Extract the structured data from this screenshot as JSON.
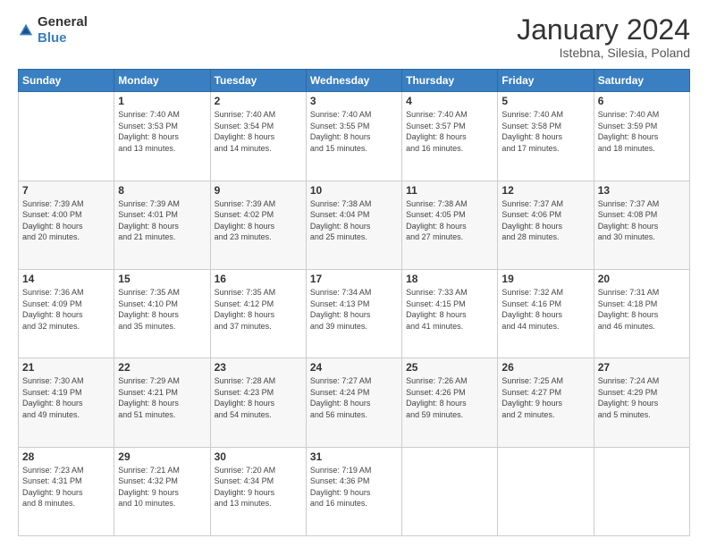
{
  "header": {
    "logo": {
      "general": "General",
      "blue": "Blue"
    },
    "title": "January 2024",
    "location": "Istebna, Silesia, Poland"
  },
  "calendar": {
    "days_of_week": [
      "Sunday",
      "Monday",
      "Tuesday",
      "Wednesday",
      "Thursday",
      "Friday",
      "Saturday"
    ],
    "weeks": [
      [
        {
          "day": "",
          "info": ""
        },
        {
          "day": "1",
          "info": "Sunrise: 7:40 AM\nSunset: 3:53 PM\nDaylight: 8 hours\nand 13 minutes."
        },
        {
          "day": "2",
          "info": "Sunrise: 7:40 AM\nSunset: 3:54 PM\nDaylight: 8 hours\nand 14 minutes."
        },
        {
          "day": "3",
          "info": "Sunrise: 7:40 AM\nSunset: 3:55 PM\nDaylight: 8 hours\nand 15 minutes."
        },
        {
          "day": "4",
          "info": "Sunrise: 7:40 AM\nSunset: 3:57 PM\nDaylight: 8 hours\nand 16 minutes."
        },
        {
          "day": "5",
          "info": "Sunrise: 7:40 AM\nSunset: 3:58 PM\nDaylight: 8 hours\nand 17 minutes."
        },
        {
          "day": "6",
          "info": "Sunrise: 7:40 AM\nSunset: 3:59 PM\nDaylight: 8 hours\nand 18 minutes."
        }
      ],
      [
        {
          "day": "7",
          "info": "Sunrise: 7:39 AM\nSunset: 4:00 PM\nDaylight: 8 hours\nand 20 minutes."
        },
        {
          "day": "8",
          "info": "Sunrise: 7:39 AM\nSunset: 4:01 PM\nDaylight: 8 hours\nand 21 minutes."
        },
        {
          "day": "9",
          "info": "Sunrise: 7:39 AM\nSunset: 4:02 PM\nDaylight: 8 hours\nand 23 minutes."
        },
        {
          "day": "10",
          "info": "Sunrise: 7:38 AM\nSunset: 4:04 PM\nDaylight: 8 hours\nand 25 minutes."
        },
        {
          "day": "11",
          "info": "Sunrise: 7:38 AM\nSunset: 4:05 PM\nDaylight: 8 hours\nand 27 minutes."
        },
        {
          "day": "12",
          "info": "Sunrise: 7:37 AM\nSunset: 4:06 PM\nDaylight: 8 hours\nand 28 minutes."
        },
        {
          "day": "13",
          "info": "Sunrise: 7:37 AM\nSunset: 4:08 PM\nDaylight: 8 hours\nand 30 minutes."
        }
      ],
      [
        {
          "day": "14",
          "info": "Sunrise: 7:36 AM\nSunset: 4:09 PM\nDaylight: 8 hours\nand 32 minutes."
        },
        {
          "day": "15",
          "info": "Sunrise: 7:35 AM\nSunset: 4:10 PM\nDaylight: 8 hours\nand 35 minutes."
        },
        {
          "day": "16",
          "info": "Sunrise: 7:35 AM\nSunset: 4:12 PM\nDaylight: 8 hours\nand 37 minutes."
        },
        {
          "day": "17",
          "info": "Sunrise: 7:34 AM\nSunset: 4:13 PM\nDaylight: 8 hours\nand 39 minutes."
        },
        {
          "day": "18",
          "info": "Sunrise: 7:33 AM\nSunset: 4:15 PM\nDaylight: 8 hours\nand 41 minutes."
        },
        {
          "day": "19",
          "info": "Sunrise: 7:32 AM\nSunset: 4:16 PM\nDaylight: 8 hours\nand 44 minutes."
        },
        {
          "day": "20",
          "info": "Sunrise: 7:31 AM\nSunset: 4:18 PM\nDaylight: 8 hours\nand 46 minutes."
        }
      ],
      [
        {
          "day": "21",
          "info": "Sunrise: 7:30 AM\nSunset: 4:19 PM\nDaylight: 8 hours\nand 49 minutes."
        },
        {
          "day": "22",
          "info": "Sunrise: 7:29 AM\nSunset: 4:21 PM\nDaylight: 8 hours\nand 51 minutes."
        },
        {
          "day": "23",
          "info": "Sunrise: 7:28 AM\nSunset: 4:23 PM\nDaylight: 8 hours\nand 54 minutes."
        },
        {
          "day": "24",
          "info": "Sunrise: 7:27 AM\nSunset: 4:24 PM\nDaylight: 8 hours\nand 56 minutes."
        },
        {
          "day": "25",
          "info": "Sunrise: 7:26 AM\nSunset: 4:26 PM\nDaylight: 8 hours\nand 59 minutes."
        },
        {
          "day": "26",
          "info": "Sunrise: 7:25 AM\nSunset: 4:27 PM\nDaylight: 9 hours\nand 2 minutes."
        },
        {
          "day": "27",
          "info": "Sunrise: 7:24 AM\nSunset: 4:29 PM\nDaylight: 9 hours\nand 5 minutes."
        }
      ],
      [
        {
          "day": "28",
          "info": "Sunrise: 7:23 AM\nSunset: 4:31 PM\nDaylight: 9 hours\nand 8 minutes."
        },
        {
          "day": "29",
          "info": "Sunrise: 7:21 AM\nSunset: 4:32 PM\nDaylight: 9 hours\nand 10 minutes."
        },
        {
          "day": "30",
          "info": "Sunrise: 7:20 AM\nSunset: 4:34 PM\nDaylight: 9 hours\nand 13 minutes."
        },
        {
          "day": "31",
          "info": "Sunrise: 7:19 AM\nSunset: 4:36 PM\nDaylight: 9 hours\nand 16 minutes."
        },
        {
          "day": "",
          "info": ""
        },
        {
          "day": "",
          "info": ""
        },
        {
          "day": "",
          "info": ""
        }
      ]
    ]
  }
}
